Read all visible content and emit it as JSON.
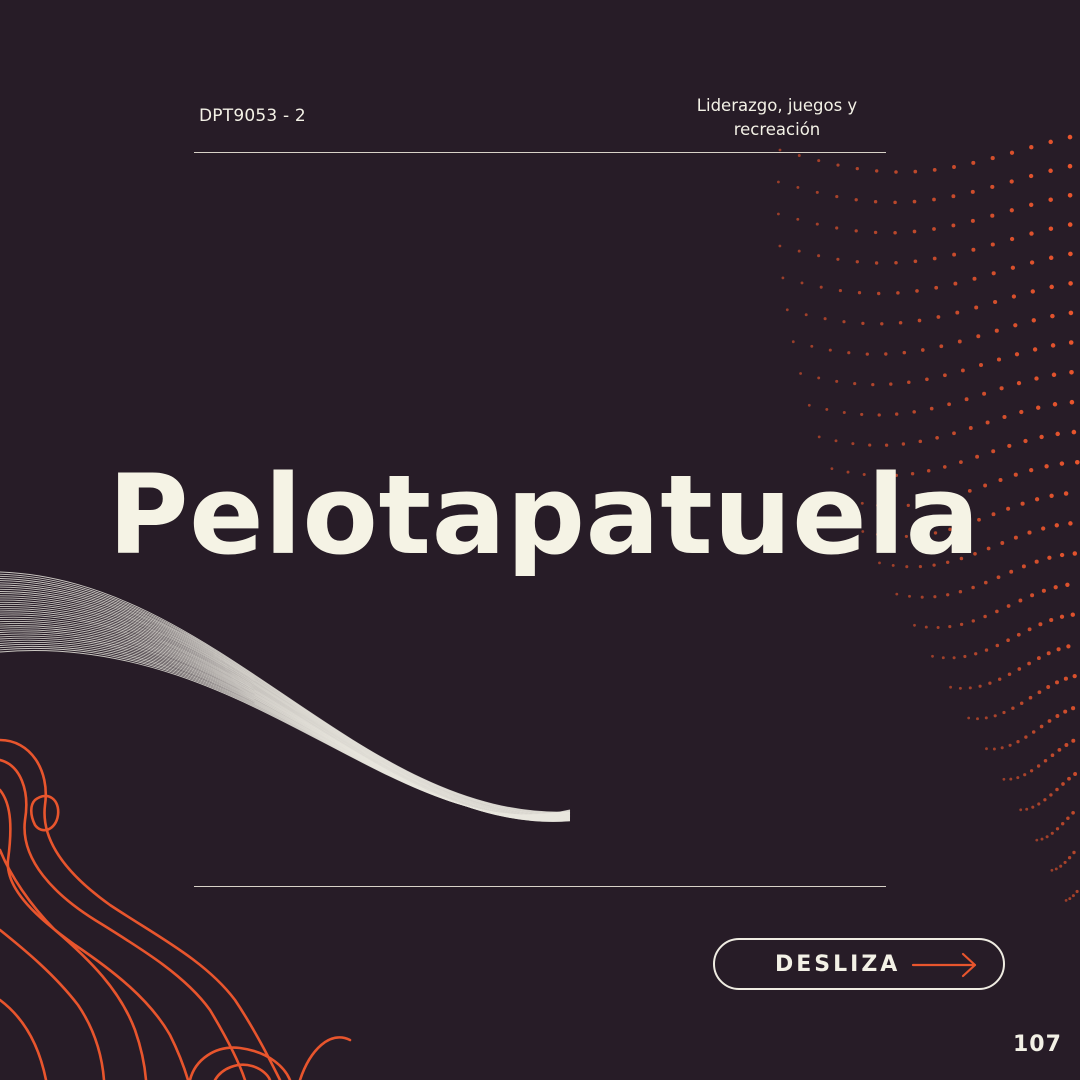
{
  "header": {
    "course_code": "DPT9053 - 2",
    "course_subject": "Liderazgo, juegos y recreación"
  },
  "main": {
    "title": "Pelotapatuela"
  },
  "footer": {
    "swipe_label": "DESLIZA",
    "page_number": "107"
  },
  "colors": {
    "background": "#271c27",
    "accent": "#e8552d",
    "text": "#f3f1e6"
  },
  "decorations": [
    "dotted-wave-graphic",
    "line-wave-graphic",
    "topographic-lines-graphic"
  ]
}
